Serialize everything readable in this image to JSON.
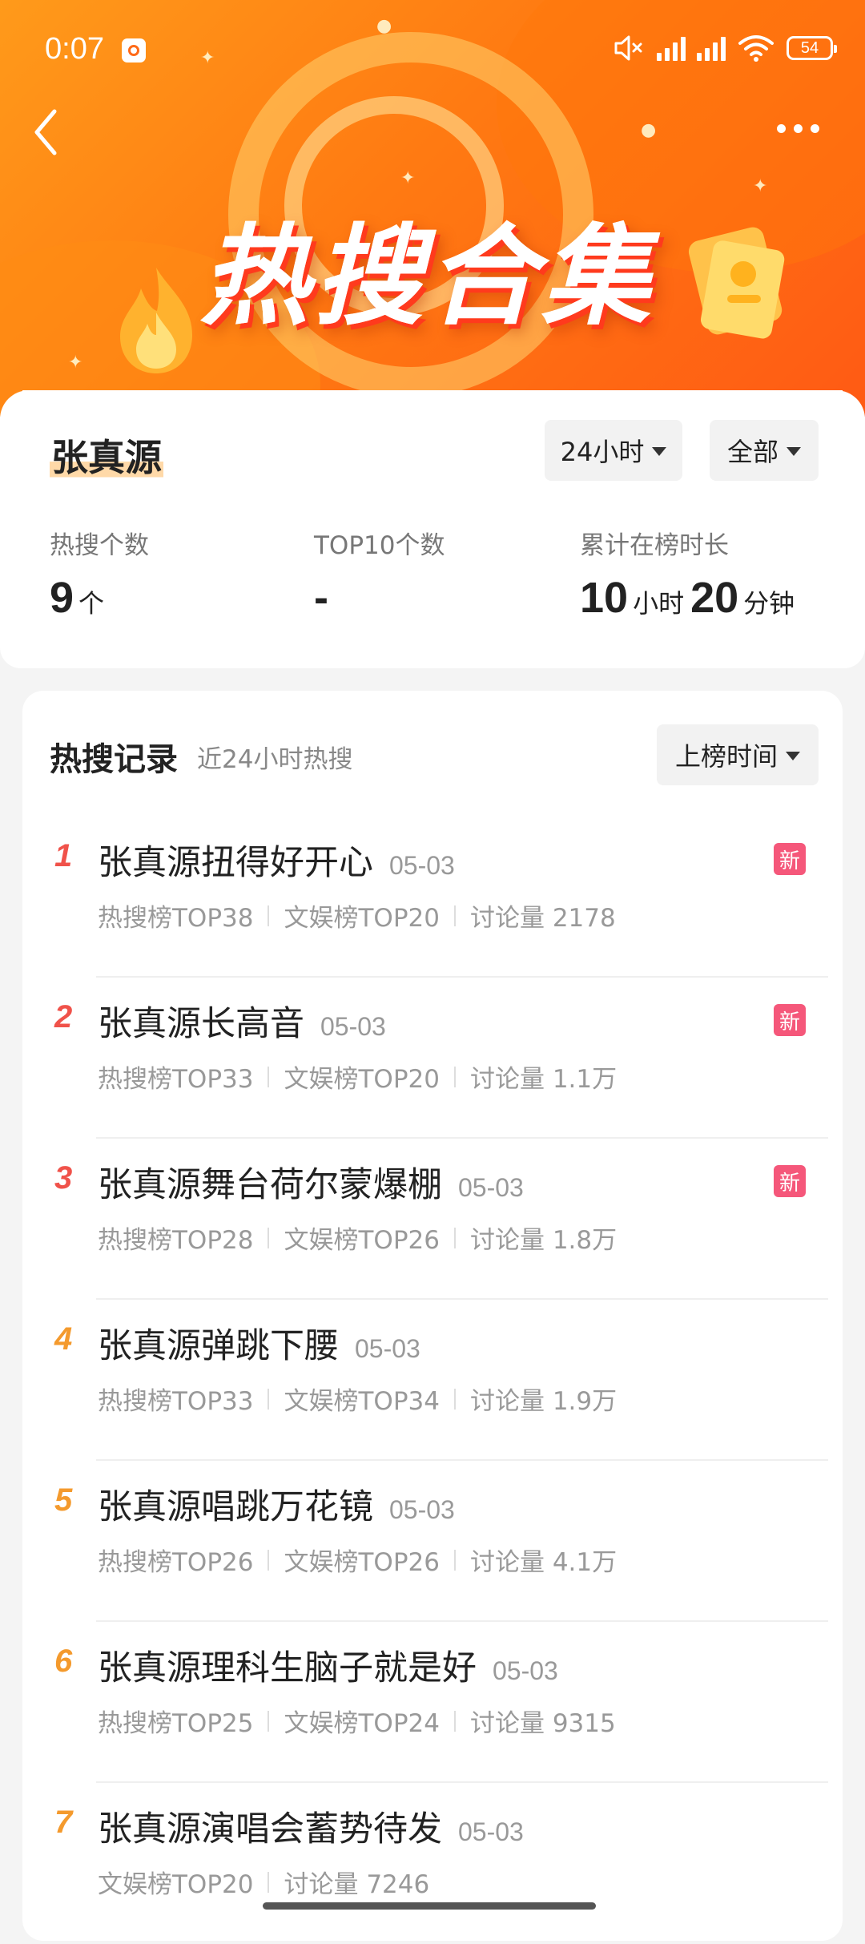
{
  "status_bar": {
    "time": "0:07",
    "battery": "54",
    "icons": [
      "record-icon",
      "mute-icon",
      "signal-icon",
      "signal-icon",
      "wifi-icon",
      "battery-icon"
    ]
  },
  "header": {
    "title": "热搜合集",
    "back_icon": "chevron-left-icon",
    "more_icon": "more-dots-icon"
  },
  "summary": {
    "name": "张真源",
    "time_filter": "24小时",
    "scope_filter": "全部",
    "stats": [
      {
        "label": "热搜个数",
        "value": "9",
        "unit": "个"
      },
      {
        "label": "TOP10个数",
        "value": "-"
      },
      {
        "label": "累计在榜时长",
        "hours": "10",
        "hours_unit": "小时",
        "minutes": "20",
        "minutes_unit": "分钟"
      }
    ]
  },
  "records": {
    "title": "热搜记录",
    "subtitle": "近24小时热搜",
    "sort_label": "上榜时间",
    "new_badge": "新",
    "items": [
      {
        "rank": "1",
        "title": "张真源扭得好开心",
        "date": "05-03",
        "meta": [
          "热搜榜TOP38",
          "文娱榜TOP20",
          "讨论量 2178"
        ],
        "is_new": true
      },
      {
        "rank": "2",
        "title": "张真源长高音",
        "date": "05-03",
        "meta": [
          "热搜榜TOP33",
          "文娱榜TOP20",
          "讨论量 1.1万"
        ],
        "is_new": true
      },
      {
        "rank": "3",
        "title": "张真源舞台荷尔蒙爆棚",
        "date": "05-03",
        "meta": [
          "热搜榜TOP28",
          "文娱榜TOP26",
          "讨论量 1.8万"
        ],
        "is_new": true
      },
      {
        "rank": "4",
        "title": "张真源弹跳下腰",
        "date": "05-03",
        "meta": [
          "热搜榜TOP33",
          "文娱榜TOP34",
          "讨论量 1.9万"
        ],
        "is_new": false
      },
      {
        "rank": "5",
        "title": "张真源唱跳万花镜",
        "date": "05-03",
        "meta": [
          "热搜榜TOP26",
          "文娱榜TOP26",
          "讨论量 4.1万"
        ],
        "is_new": false
      },
      {
        "rank": "6",
        "title": "张真源理科生脑子就是好",
        "date": "05-03",
        "meta": [
          "热搜榜TOP25",
          "文娱榜TOP24",
          "讨论量 9315"
        ],
        "is_new": false
      },
      {
        "rank": "7",
        "title": "张真源演唱会蓄势待发",
        "date": "05-03",
        "meta": [
          "文娱榜TOP20",
          "讨论量 7246"
        ],
        "is_new": false
      }
    ]
  }
}
